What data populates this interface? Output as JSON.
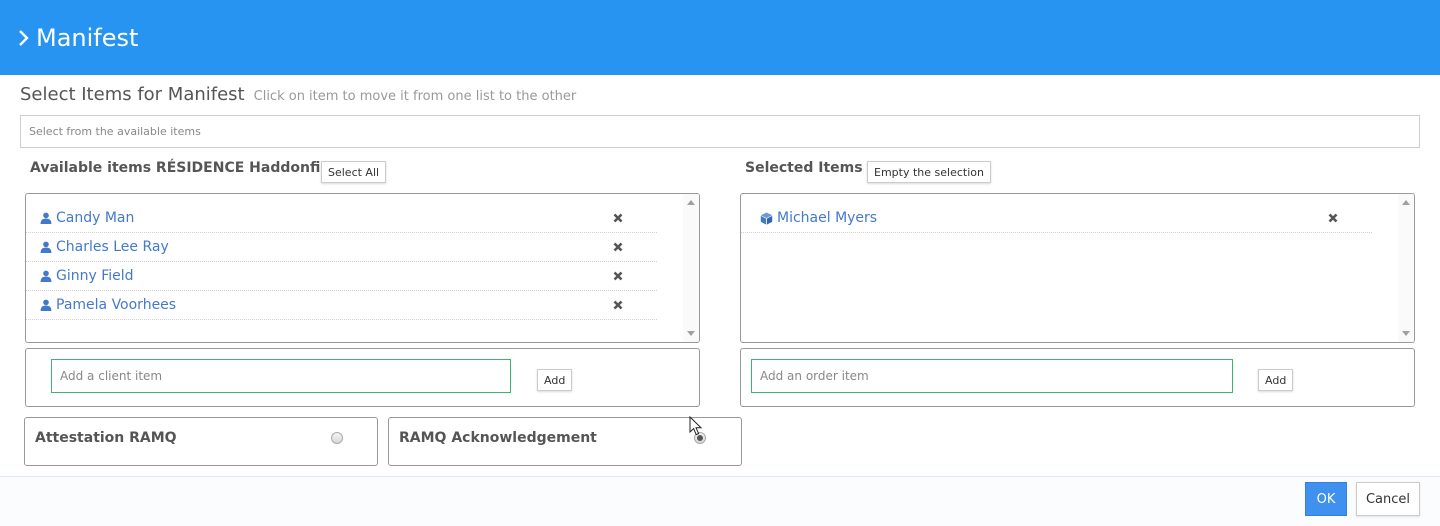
{
  "header": {
    "title": "Manifest",
    "icon": "chevron-right-icon",
    "background": "#2694f0"
  },
  "section": {
    "title": "Select Items for Manifest",
    "hint": "Click on item to move it from one list to the other"
  },
  "search": {
    "placeholder": "Select from the available items",
    "value": ""
  },
  "available": {
    "label": "Available items RÉSIDENCE Haddonfield",
    "select_all_label": "Select All",
    "items": [
      {
        "name": "Candy Man",
        "icon": "user-icon"
      },
      {
        "name": "Charles Lee Ray",
        "icon": "user-icon"
      },
      {
        "name": "Ginny Field",
        "icon": "user-icon"
      },
      {
        "name": "Pamela Voorhees",
        "icon": "user-icon"
      }
    ],
    "add_placeholder": "Add a client item",
    "add_label": "Add"
  },
  "selected": {
    "label": "Selected Items",
    "empty_label": "Empty the selection",
    "items": [
      {
        "name": "Michael Myers",
        "icon": "cube-icon"
      }
    ],
    "add_placeholder": "Add an order item",
    "add_label": "Add"
  },
  "options": [
    {
      "label": "Attestation RAMQ",
      "checked": false
    },
    {
      "label": "RAMQ Acknowledgement",
      "checked": true
    }
  ],
  "footer": {
    "ok_label": "OK",
    "cancel_label": "Cancel"
  },
  "colors": {
    "accent": "#3f90ef",
    "link": "#4479c9",
    "input_border": "#3cb371"
  }
}
